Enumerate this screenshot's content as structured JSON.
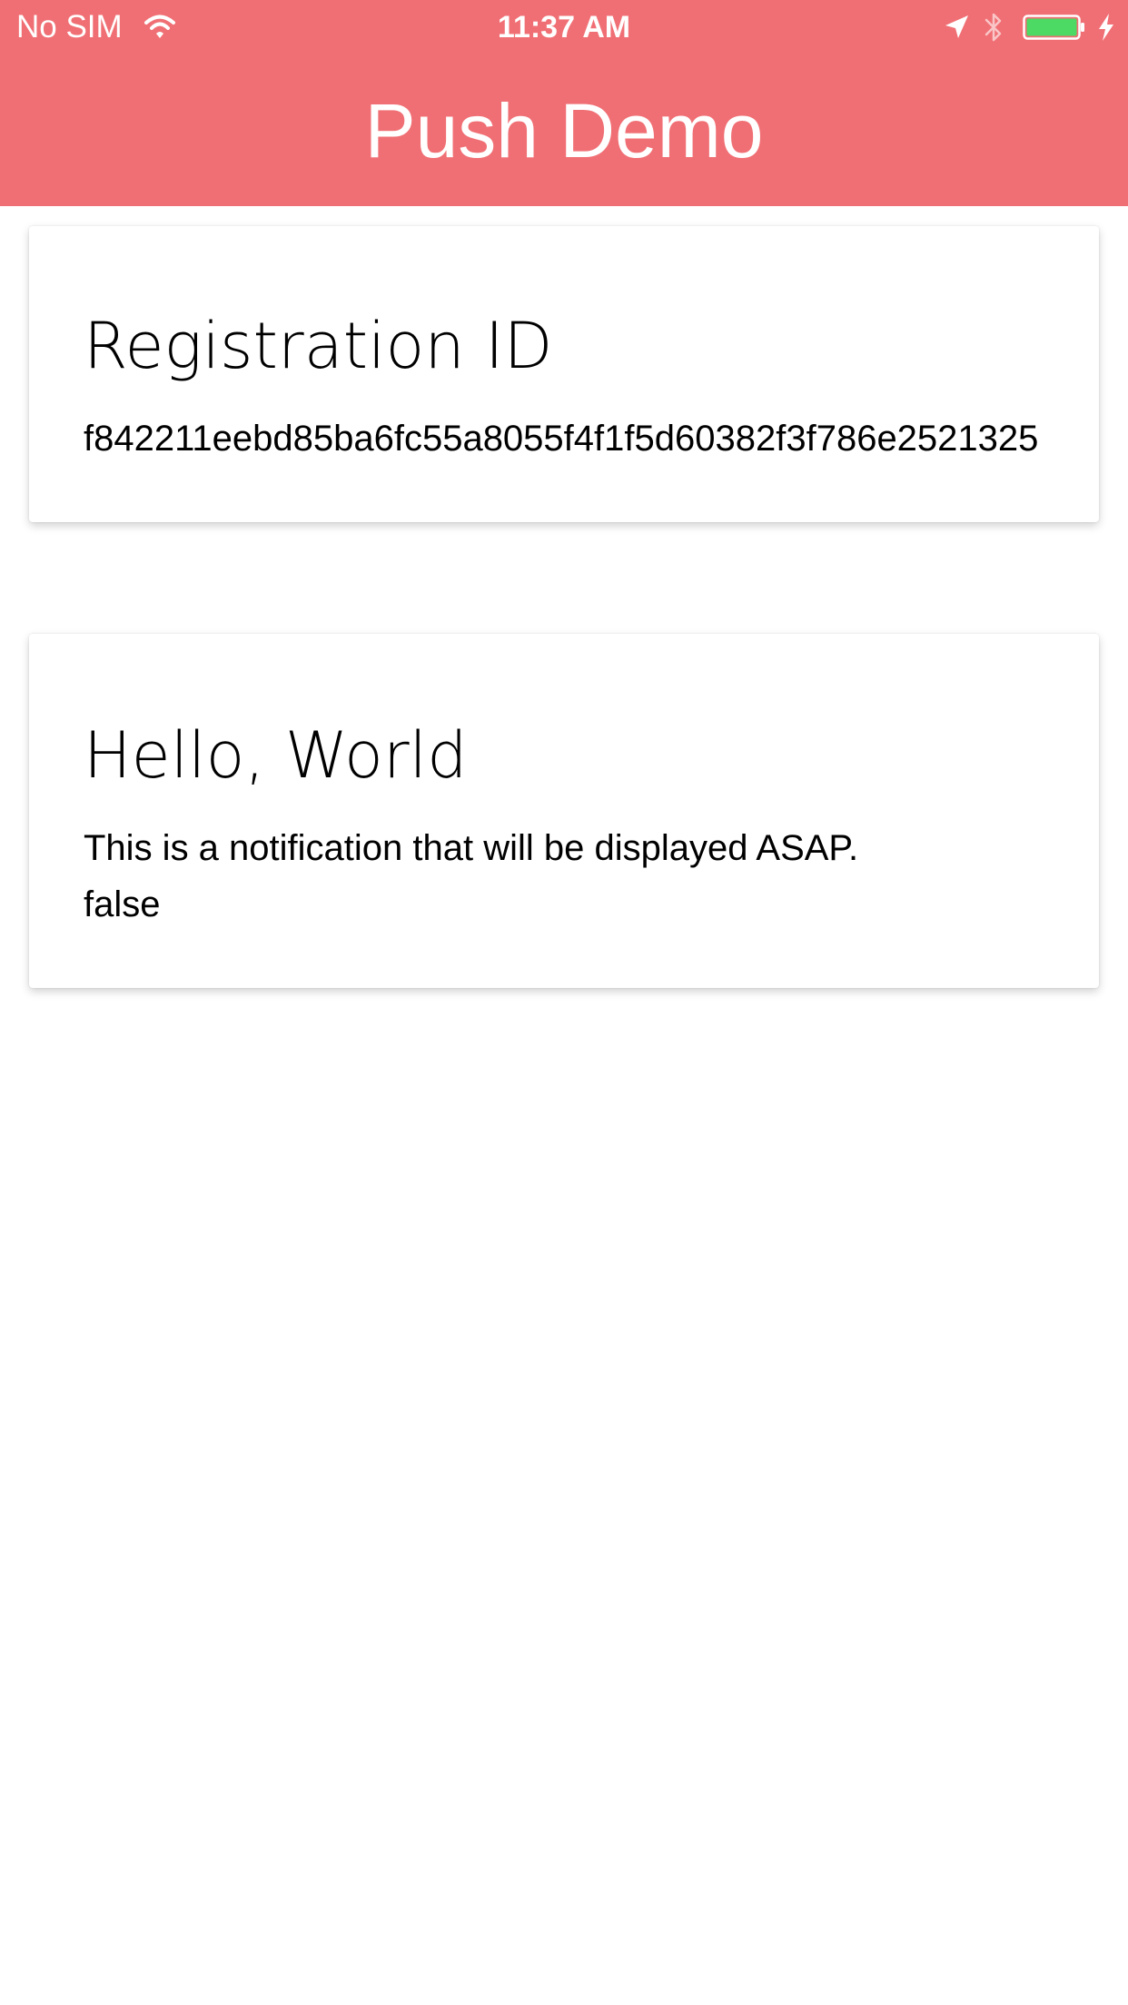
{
  "status_bar": {
    "carrier": "No SIM",
    "time": "11:37 AM"
  },
  "header": {
    "title": "Push Demo",
    "background_color": "#f06f74"
  },
  "registration_card": {
    "title": "Registration ID",
    "value": "f842211eebd85ba6fc55a8055f4f1f5d60382f3f786e2521325"
  },
  "notification_card": {
    "title": "Hello, World",
    "message": "This is a notification that will be displayed ASAP.",
    "flag": "false"
  },
  "icons": {
    "wifi": "wifi-icon",
    "location": "location-arrow-icon",
    "bluetooth": "bluetooth-icon",
    "battery": "battery-icon",
    "charging": "charging-bolt-icon",
    "battery_fill_color": "#4cd964"
  }
}
